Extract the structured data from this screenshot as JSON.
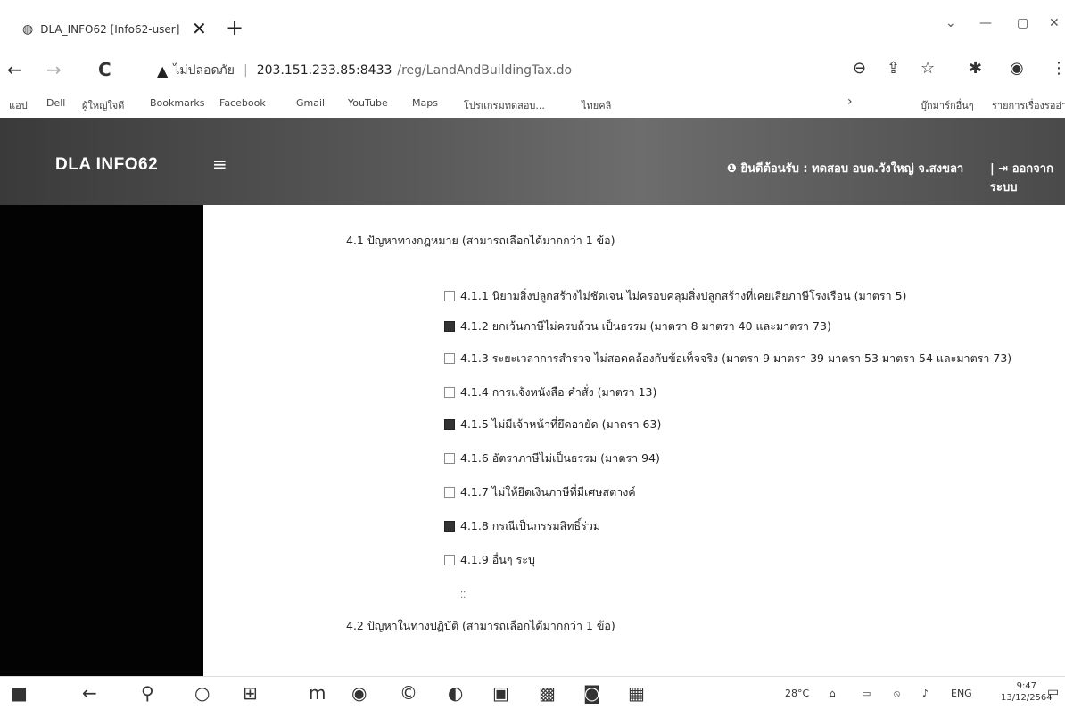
{
  "browser": {
    "tab_title": "DLA_INFO62 [Info62-user]",
    "tab_close": "✕",
    "tab_new": "+",
    "window_controls": [
      "⌄",
      "—",
      "▢",
      "✕"
    ],
    "nav": {
      "back": "←",
      "forward": "→",
      "reload": "C"
    },
    "address": {
      "warning": "▲",
      "insecure_label": "ไม่ปลอดภัย",
      "host": "203.151.233.85:8433",
      "path": "/reg/LandAndBuildingTax.do"
    },
    "toolbar_icons": [
      "⊖",
      "⇪",
      "☆",
      "✱",
      "◉",
      "⋮"
    ],
    "bookmarks": [
      "แอป",
      "Dell",
      "ผู้ใหญ่ใจดี",
      "Bookmarks",
      "Facebook",
      "Gmail",
      "YouTube",
      "Maps",
      "โปรแกรมทดสอบ...",
      "ไทยคลิ"
    ],
    "bookmarks_right": [
      "›",
      "บุ๊กมาร์กอื่นๆ",
      "รายการเรื่องรออ่าน"
    ]
  },
  "app": {
    "brand": "DLA INFO62",
    "menu_icon": "≡",
    "welcome": "❶ ยินดีต้อนรับ : ทดสอบ อบต.วังใหญ่ จ.สงขลา",
    "logout": "| ⇥ ออกจากระบบ"
  },
  "section1": {
    "heading": "4.1 ปัญหาทางกฎหมาย (สามารถเลือกได้มากกว่า 1 ข้อ)",
    "options": [
      {
        "label": "4.1.1 นิยามสิ่งปลูกสร้างไม่ชัดเจน ไม่ครอบคลุมสิ่งปลูกสร้างที่เคยเสียภาษีโรงเรือน (มาตรา 5)",
        "checked": false
      },
      {
        "label": "4.1.2 ยกเว้นภาษีไม่ครบถ้วน เป็นธรรม (มาตรา 8 มาตรา 40 และมาตรา 73)",
        "checked": true
      },
      {
        "label": "4.1.3 ระยะเวลาการสำรวจ ไม่สอดคล้องกับข้อเท็จจริง (มาตรา 9 มาตรา 39 มาตรา 53 มาตรา 54 และมาตรา 73)",
        "checked": false
      },
      {
        "label": "4.1.4 การแจ้งหนังสือ คำสั่ง (มาตรา 13)",
        "checked": false
      },
      {
        "label": "4.1.5 ไม่มีเจ้าหน้าที่ยึดอายัด (มาตรา 63)",
        "checked": true
      },
      {
        "label": "4.1.6 อัตราภาษีไม่เป็นธรรม (มาตรา 94)",
        "checked": false
      },
      {
        "label": "4.1.7 ไม่ให้ยึดเงินภาษีที่มีเศษสตางค์",
        "checked": false
      },
      {
        "label": "4.1.8 กรณีเป็นกรรมสิทธิ์ร่วม",
        "checked": true
      },
      {
        "label": "4.1.9 อื่นๆ ระบุ",
        "checked": false
      }
    ],
    "textarea_handle": "⁚⁚"
  },
  "section2": {
    "heading": "4.2 ปัญหาในทางปฏิบัติ (สามารถเลือกได้มากกว่า 1 ข้อ)"
  },
  "taskbar": {
    "icons": [
      "■",
      "←",
      "⚲",
      "○",
      "⊞",
      "m",
      "◉",
      "©",
      "◐",
      "▣",
      "▩",
      "◙",
      "▦"
    ],
    "weather": "28°C",
    "tray": [
      "⌂",
      "▭",
      "⦸",
      "♪"
    ],
    "lang": "ENG",
    "time": "9:47",
    "date": "13/12/2564",
    "notify": "▭"
  }
}
